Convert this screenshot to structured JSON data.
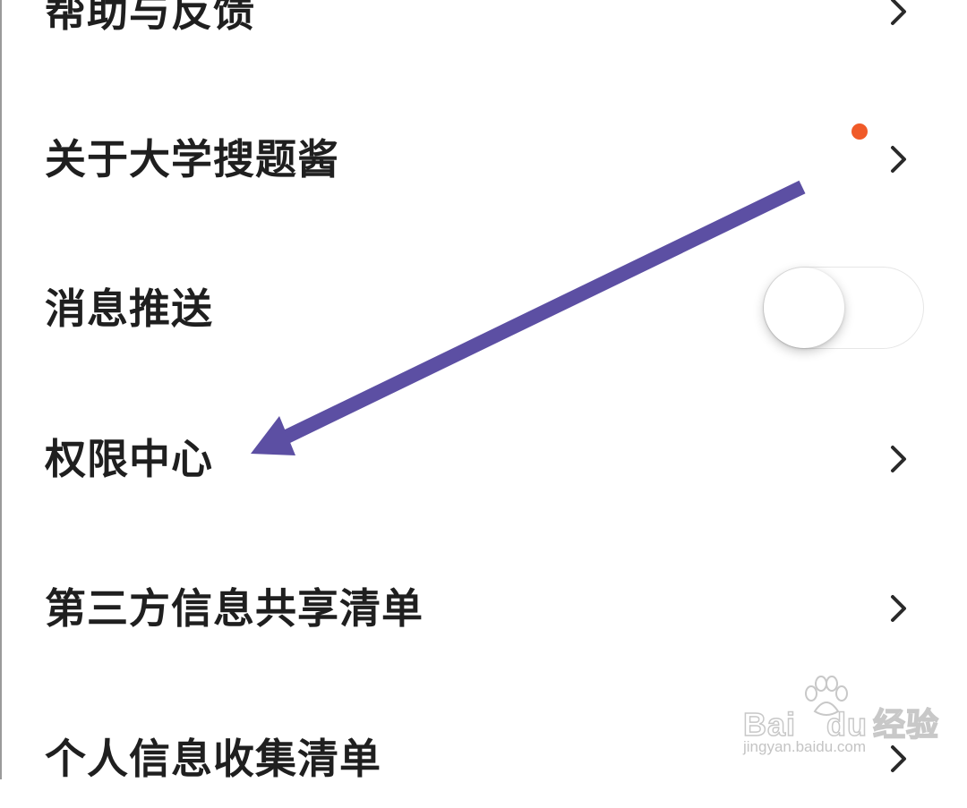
{
  "settings": {
    "items": [
      {
        "label": "帮助与反馈",
        "control": "chevron"
      },
      {
        "label": "关于大学搜题酱",
        "control": "chevron",
        "badge": "red-dot"
      },
      {
        "label": "消息推送",
        "control": "toggle",
        "toggle_on": false
      },
      {
        "label": "权限中心",
        "control": "chevron"
      },
      {
        "label": "第三方信息共享清单",
        "control": "chevron"
      },
      {
        "label": "个人信息收集清单",
        "control": "chevron"
      }
    ]
  },
  "icons": {
    "chevron": "chevron-right-icon",
    "badge": "notification-dot-icon",
    "annotation": "arrow-annotation-icon"
  },
  "watermark": {
    "brand_prefix": "Bai",
    "brand_suffix": "du",
    "brand_cn": "经验",
    "url": "jingyan.baidu.com"
  },
  "colors": {
    "text": "#1f1f1f",
    "chevron": "#2a2a2a",
    "badge": "#f05a28",
    "annotation_arrow": "#5c4fa3",
    "toggle_off": "#ffffff"
  }
}
